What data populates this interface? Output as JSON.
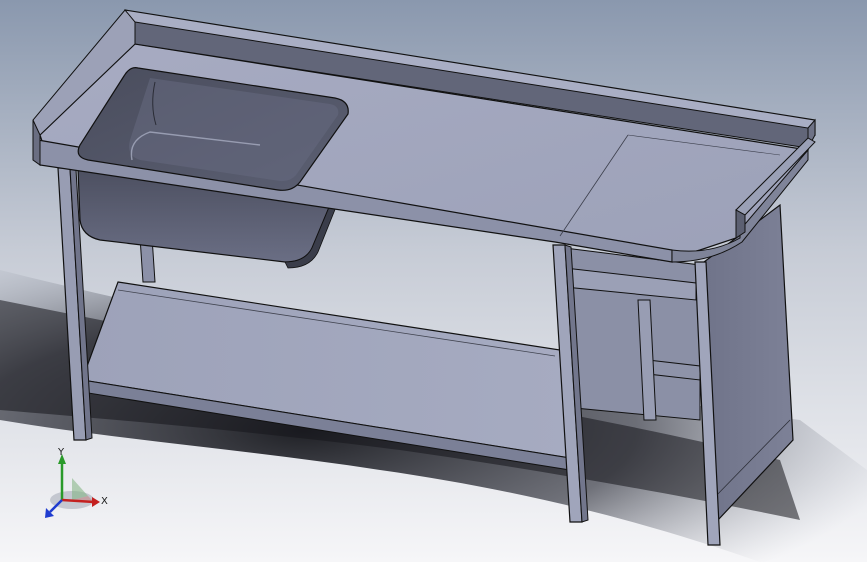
{
  "view": {
    "background_top": "#8d9bb0",
    "background_bottom": "#f2f3f5",
    "shadow_color": "#1c1d22",
    "steel_light": "#a3a8bf",
    "steel_mid": "#80859e",
    "steel_dark": "#3c3f4c",
    "edge": "#101015"
  },
  "triad": {
    "x_label": "X",
    "y_label": "Y",
    "x_color": "#c42020",
    "y_color": "#2a9a2a",
    "z_color": "#1f3ccf"
  }
}
